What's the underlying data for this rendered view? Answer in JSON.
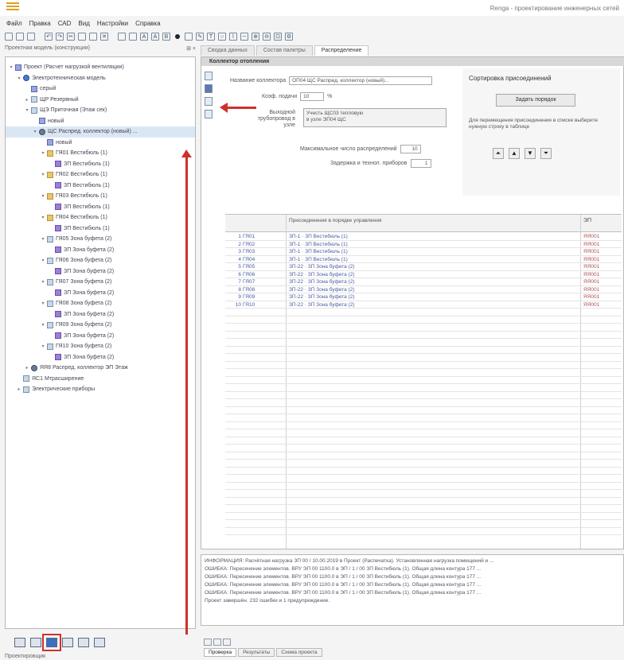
{
  "window": {
    "title": "Renga - проектирование инженерных сетей"
  },
  "menu": [
    "Файл",
    "Правка",
    "САD",
    "Вид",
    "Настройки",
    "Справка"
  ],
  "left": {
    "header": "Проектная модель (конструкции)",
    "tree": [
      {
        "l": 0,
        "t": "Проект (Расчет нагрузкой вентиляции)",
        "i": "doc",
        "tg": "▾"
      },
      {
        "l": 1,
        "t": "Электротехническая модель",
        "i": "blue",
        "tg": "▾"
      },
      {
        "l": 2,
        "t": "серый",
        "i": "doc",
        "tg": ""
      },
      {
        "l": 2,
        "t": "ЩР Резервный",
        "i": "tube",
        "tg": "▸"
      },
      {
        "l": 2,
        "t": "ЩЭ Приточная (Этаж сек)",
        "i": "tube",
        "tg": "▾"
      },
      {
        "l": 3,
        "t": "новый",
        "i": "doc",
        "tg": ""
      },
      {
        "l": 3,
        "t": "ЩС Распред. коллектор (новый) ...",
        "i": "cab",
        "tg": "▾",
        "sel": true
      },
      {
        "l": 4,
        "t": "новый",
        "i": "doc",
        "tg": ""
      },
      {
        "l": 4,
        "t": "ГЯ01 Вестибюль (1)",
        "i": "folder",
        "tg": "▾"
      },
      {
        "l": 5,
        "t": "ЗП Вестибюль (1)",
        "i": "room",
        "tg": ""
      },
      {
        "l": 4,
        "t": "ГЯ02 Вестибюль (1)",
        "i": "folder",
        "tg": "▾"
      },
      {
        "l": 5,
        "t": "ЗП Вестибюль (1)",
        "i": "room",
        "tg": ""
      },
      {
        "l": 4,
        "t": "ГЯ03 Вестибюль (1)",
        "i": "folder",
        "tg": "▾"
      },
      {
        "l": 5,
        "t": "ЗП Вестибюль (1)",
        "i": "room",
        "tg": ""
      },
      {
        "l": 4,
        "t": "ГЯ04 Вестибюль (1)",
        "i": "folder",
        "tg": "▾"
      },
      {
        "l": 5,
        "t": "ЗП Вестибюль (1)",
        "i": "room",
        "tg": ""
      },
      {
        "l": 4,
        "t": "ГЯ05 Зона буфета (2)",
        "i": "tube",
        "tg": "▾"
      },
      {
        "l": 5,
        "t": "ЗП Зона буфета (2)",
        "i": "room",
        "tg": ""
      },
      {
        "l": 4,
        "t": "ГЯ06 Зона буфета (2)",
        "i": "tube",
        "tg": "▾"
      },
      {
        "l": 5,
        "t": "ЗП Зона буфета (2)",
        "i": "room",
        "tg": ""
      },
      {
        "l": 4,
        "t": "ГЯ07 Зона буфета (2)",
        "i": "tube",
        "tg": "▾"
      },
      {
        "l": 5,
        "t": "ЗП Зона буфета (2)",
        "i": "room",
        "tg": ""
      },
      {
        "l": 4,
        "t": "ГЯ08 Зона буфета (2)",
        "i": "tube",
        "tg": "▾"
      },
      {
        "l": 5,
        "t": "ЗП Зона буфета (2)",
        "i": "room",
        "tg": ""
      },
      {
        "l": 4,
        "t": "ГЯ09 Зона буфета (2)",
        "i": "tube",
        "tg": "▾"
      },
      {
        "l": 5,
        "t": "ЗП Зона буфета (2)",
        "i": "room",
        "tg": ""
      },
      {
        "l": 4,
        "t": "ГЯ10 Зона буфета (2)",
        "i": "tube",
        "tg": "▾"
      },
      {
        "l": 5,
        "t": "ЗП Зона буфета (2)",
        "i": "room",
        "tg": ""
      },
      {
        "l": 2,
        "t": "ЯЯ8 Распред. коллектор ЭП Этаж",
        "i": "cab",
        "tg": "▸"
      },
      {
        "l": 1,
        "t": "ЯС1 Мтрасширение",
        "i": "tube",
        "tg": ""
      },
      {
        "l": 1,
        "t": "Электрические приборы",
        "i": "tube",
        "tg": "▸"
      }
    ],
    "toolbar": [
      "list",
      "tree",
      "schema",
      "table",
      "grid",
      "layers"
    ],
    "status": "Проектировщик"
  },
  "tabs": [
    "Сводка данных",
    "Состав палитры",
    "Распределение"
  ],
  "panel": {
    "title": "Коллектор отопления",
    "labels": {
      "name": "Название коллектора",
      "step": "Коэф. подачи",
      "cab": "Выходной трубопровод в узле",
      "max": "Максимальное число распределений",
      "reserve": "Задержка и технол. приборов"
    },
    "values": {
      "name": "ОП04 ЩС Распред. коллектор (новый)...",
      "step": "10",
      "step_unit": "%",
      "cab1": "Учесть ЩС03 тепловую",
      "cab2": "в узле ЭП04 ЩС",
      "max": "10",
      "reserve": "1"
    },
    "sort": {
      "title": "Сортировка присоединений",
      "button": "Задать порядок",
      "note": "Для перемещения присоединения в списке выберите нужную строку в таблице"
    }
  },
  "grid": {
    "head1": "Присоединения в порядке управления",
    "head2": "ЭП",
    "rows": [
      {
        "n": "1",
        "c": "ГЯ01",
        "d": "ЗП-1 · ЗП Вестибюль (1)",
        "e": "ЯЯ001"
      },
      {
        "n": "2",
        "c": "ГЯ02",
        "d": "ЗП-1 · ЗП Вестибюль (1)",
        "e": "ЯЯ001"
      },
      {
        "n": "3",
        "c": "ГЯ03",
        "d": "ЗП-1 · ЗП Вестибюль (1)",
        "e": "ЯЯ001"
      },
      {
        "n": "4",
        "c": "ГЯ04",
        "d": "ЗП-1 · ЗП Вестибюль (1)",
        "e": "ЯЯ001"
      },
      {
        "n": "5",
        "c": "ГЯ05",
        "d": "ЗП-22 · ЗП Зона буфета (2)",
        "e": "ЯЯ001"
      },
      {
        "n": "6",
        "c": "ГЯ06",
        "d": "ЗП-22 · ЗП Зона буфета (2)",
        "e": "ЯЯ001"
      },
      {
        "n": "7",
        "c": "ГЯ07",
        "d": "ЗП-22 · ЗП Зона буфета (2)",
        "e": "ЯЯ001"
      },
      {
        "n": "8",
        "c": "ГЯ08",
        "d": "ЗП-22 · ЗП Зона буфета (2)",
        "e": "ЯЯ001"
      },
      {
        "n": "9",
        "c": "ГЯ09",
        "d": "ЗП-22 · ЗП Зона буфета (2)",
        "e": "ЯЯ001"
      },
      {
        "n": "10",
        "c": "ГЯ10",
        "d": "ЗП-22 · ЗП Зона буфета (2)",
        "e": "ЯЯ001"
      }
    ]
  },
  "log": [
    "ИНФОРМАЦИЯ: Расчётная нагрузка ЗП 00 / 10.00.2019 в Проект (Распечатка). Установленная нагрузка помещений и ...",
    "ОШИБКА: Пересечение элементов. ВРУ ЭП 00 1100.0 в ЭП / 1 / 00 ЗП Вестибюль (1). Общая длина контура 177 ...",
    "ОШИБКА: Пересечение элементов. ВРУ ЭП 00 1100.0 в ЭП / 1 / 00 ЗП Вестибюль (1). Общая длина контура 177 ...",
    "ОШИБКА: Пересечение элементов. ВРУ ЭП 00 1100.0 в ЭП / 1 / 00 ЗП Вестибюль (1). Общая длина контура 177 ...",
    "ОШИБКА: Пересечение элементов. ВРУ ЭП 00 1100.0 в ЭП / 1 / 00 ЗП Вестибюль (1). Общая длина контура 177 ...",
    "Проект завершён. 232 ошибки и 1 предупреждение."
  ],
  "bottomtabs": [
    "Проверка",
    "Результаты",
    "Схема проекта"
  ],
  "colors": {
    "accent": "#d0302c",
    "selection": "#dbe6f4"
  }
}
